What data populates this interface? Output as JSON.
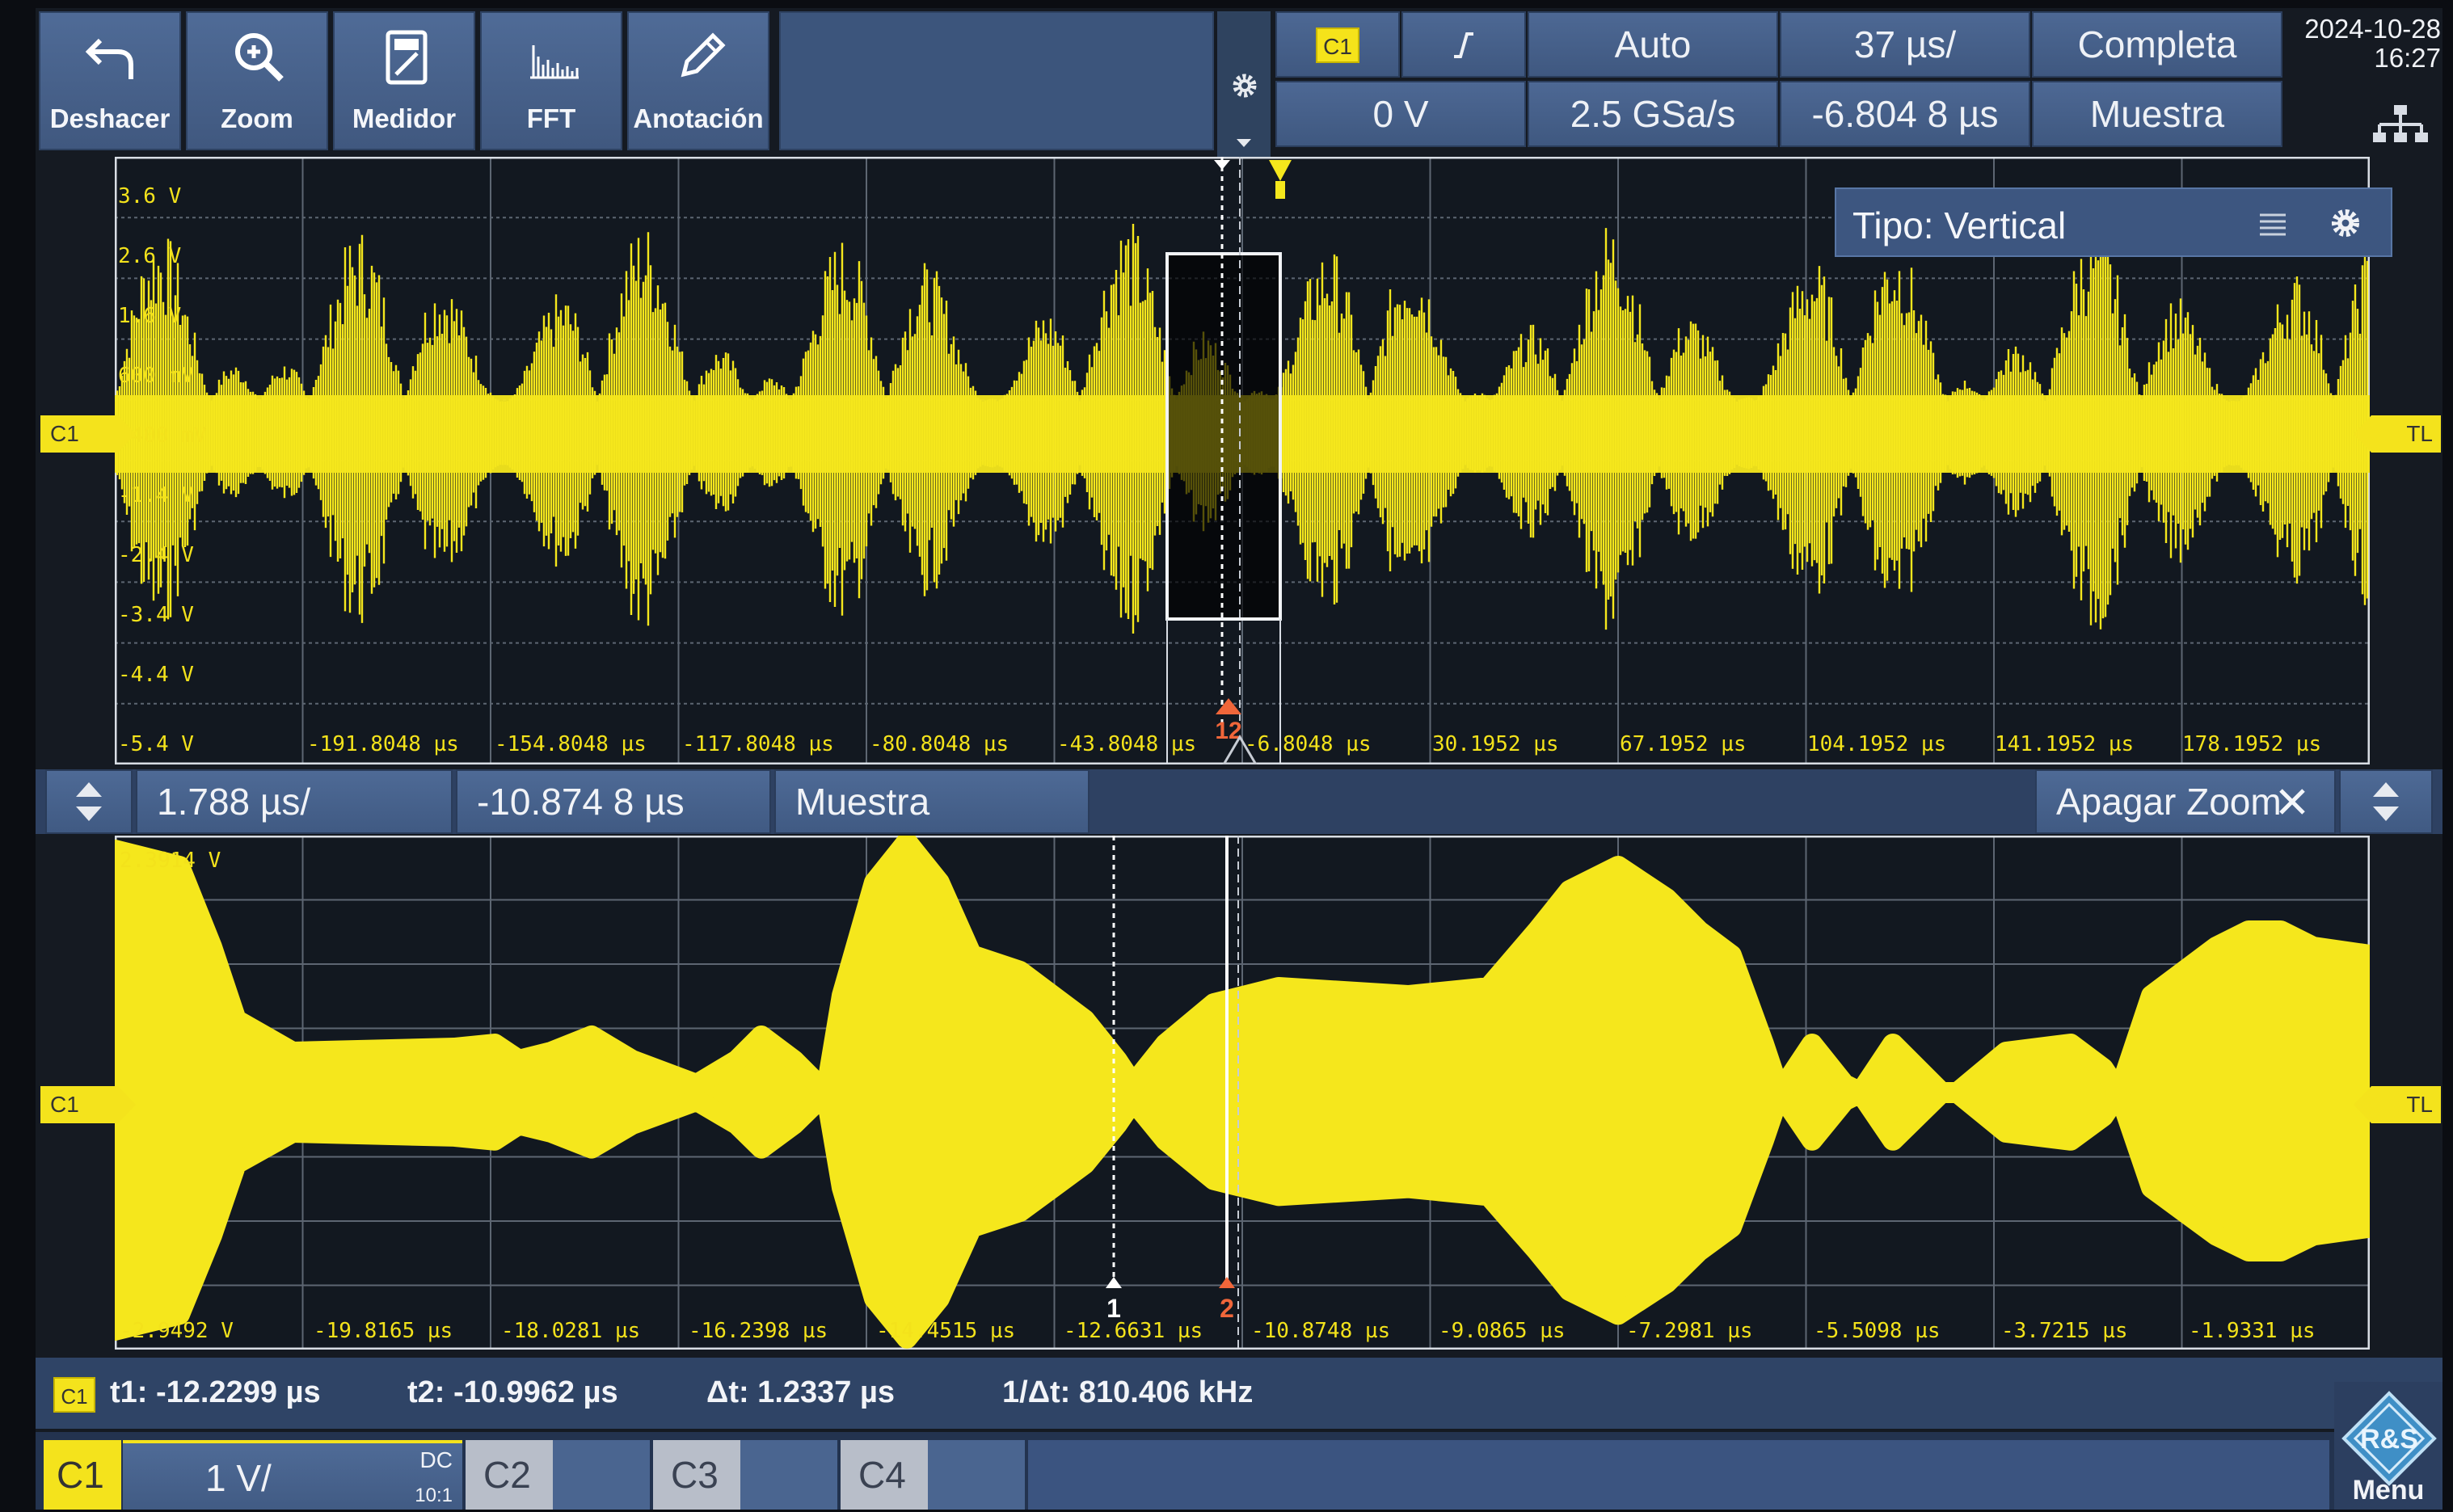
{
  "toolbar": {
    "undo_label": "Deshacer",
    "zoom_label": "Zoom",
    "meter_label": "Medidor",
    "fft_label": "FFT",
    "annotation_label": "Anotación"
  },
  "acquisition": {
    "trigger_channel": "C1",
    "trigger_mode": "Auto",
    "time_per_div": "37 µs/",
    "record_mode": "Completa",
    "trigger_level": "0 V",
    "sample_rate": "2.5 GSa/s",
    "horizontal_position": "-6.804 8 µs",
    "acquisition_mode": "Muestra"
  },
  "clock": {
    "date": "2024-10-28",
    "time": "16:27"
  },
  "overview": {
    "vertical_labels": [
      "3.6 V",
      "2.6 V",
      "1.6 V",
      "600 mV",
      "-400 mV",
      "-1.4 V",
      "-2.4 V",
      "-3.4 V",
      "-4.4 V",
      "-5.4 V"
    ],
    "time_labels": [
      "-191.8048 µs",
      "-154.8048 µs",
      "-117.8048 µs",
      "-80.8048 µs",
      "-43.8048 µs",
      "-6.8048 µs",
      "30.1952 µs",
      "67.1952 µs",
      "104.1952 µs",
      "141.1952 µs",
      "178.1952 µs"
    ],
    "channel_marker": "C1",
    "tl_marker": "TL",
    "cursor_marker_label": "12",
    "vertical_type_box": "Tipo: Vertical"
  },
  "zoom_bar": {
    "time_per_div": "1.788 µs/",
    "position": "-10.874 8 µs",
    "mode": "Muestra",
    "off_label": "Apagar Zoom"
  },
  "zoom_view": {
    "top_label": "2.3914 V",
    "bottom_label": "-2.9492 V",
    "time_labels": [
      "-19.8165 µs",
      "-18.0281 µs",
      "-16.2398 µs",
      "-14.4515 µs",
      "-12.6631 µs",
      "-10.8748 µs",
      "-9.0865 µs",
      "-7.2981 µs",
      "-5.5098 µs",
      "-3.7215 µs",
      "-1.9331 µs"
    ],
    "channel_marker": "C1",
    "tl_marker": "TL",
    "cursor1_label": "1",
    "cursor2_label": "2"
  },
  "cursor_readout": {
    "channel": "C1",
    "t1": "t1: -12.2299 µs",
    "t2": "t2: -10.9962 µs",
    "dt": "Δt: 1.2337 µs",
    "inv_dt": "1/Δt: 810.406 kHz"
  },
  "channel_bar": {
    "c1_label": "C1",
    "c1_scale": "1 V/",
    "c1_coupling": "DC",
    "c1_attenuation": "10:1",
    "c2_label": "C2",
    "c3_label": "C3",
    "c4_label": "C4",
    "menu_label": "Menu"
  },
  "colors": {
    "trace": "#f5e71c",
    "ui_blue": "#435d87",
    "plot_bg": "#121820",
    "cursor_marker": "#f0663a"
  },
  "icons": [
    "undo-icon",
    "zoom-icon",
    "meter-icon",
    "fft-icon",
    "annotation-icon",
    "gear-icon",
    "network-icon",
    "list-icon",
    "close-icon",
    "rs-logo-icon"
  ]
}
